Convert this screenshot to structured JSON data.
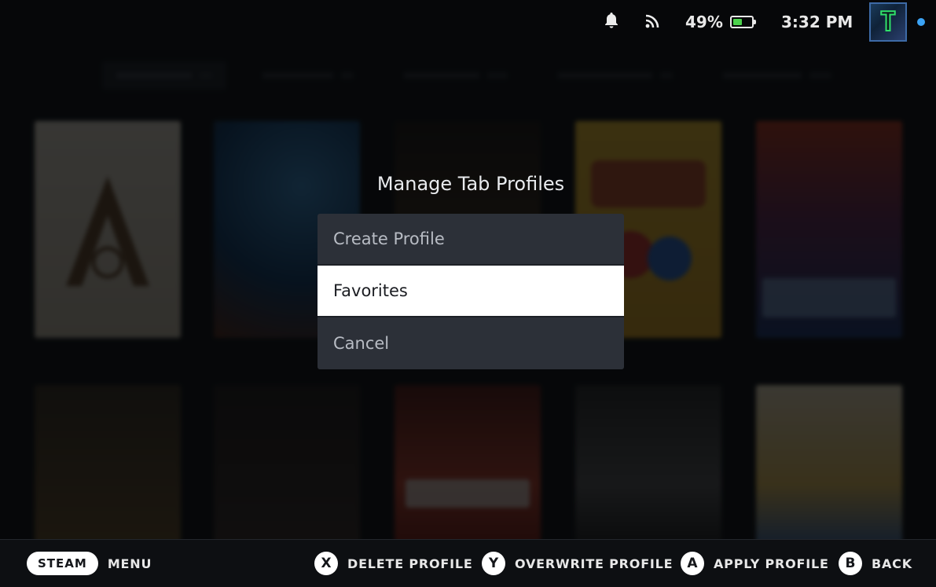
{
  "status_bar": {
    "notification_icon": "bell-icon",
    "network_icon": "wifi-signal-icon",
    "battery_percent": "49%",
    "battery_level": 0.49,
    "battery_color": "#4cd24c",
    "time": "3:32 PM",
    "avatar_letter": "T",
    "online_indicator_color": "#3ba3f5"
  },
  "dialog": {
    "title": "Manage Tab Profiles",
    "items": [
      {
        "label": "Create Profile",
        "focused": false
      },
      {
        "label": "Favorites",
        "focused": true
      },
      {
        "label": "Cancel",
        "focused": false
      }
    ]
  },
  "footer": {
    "steam_button": "STEAM",
    "menu_label": "MENU",
    "actions": [
      {
        "glyph": "X",
        "label": "DELETE PROFILE"
      },
      {
        "glyph": "Y",
        "label": "OVERWRITE PROFILE"
      },
      {
        "glyph": "A",
        "label": "APPLY PROFILE"
      },
      {
        "glyph": "B",
        "label": "BACK"
      }
    ]
  }
}
